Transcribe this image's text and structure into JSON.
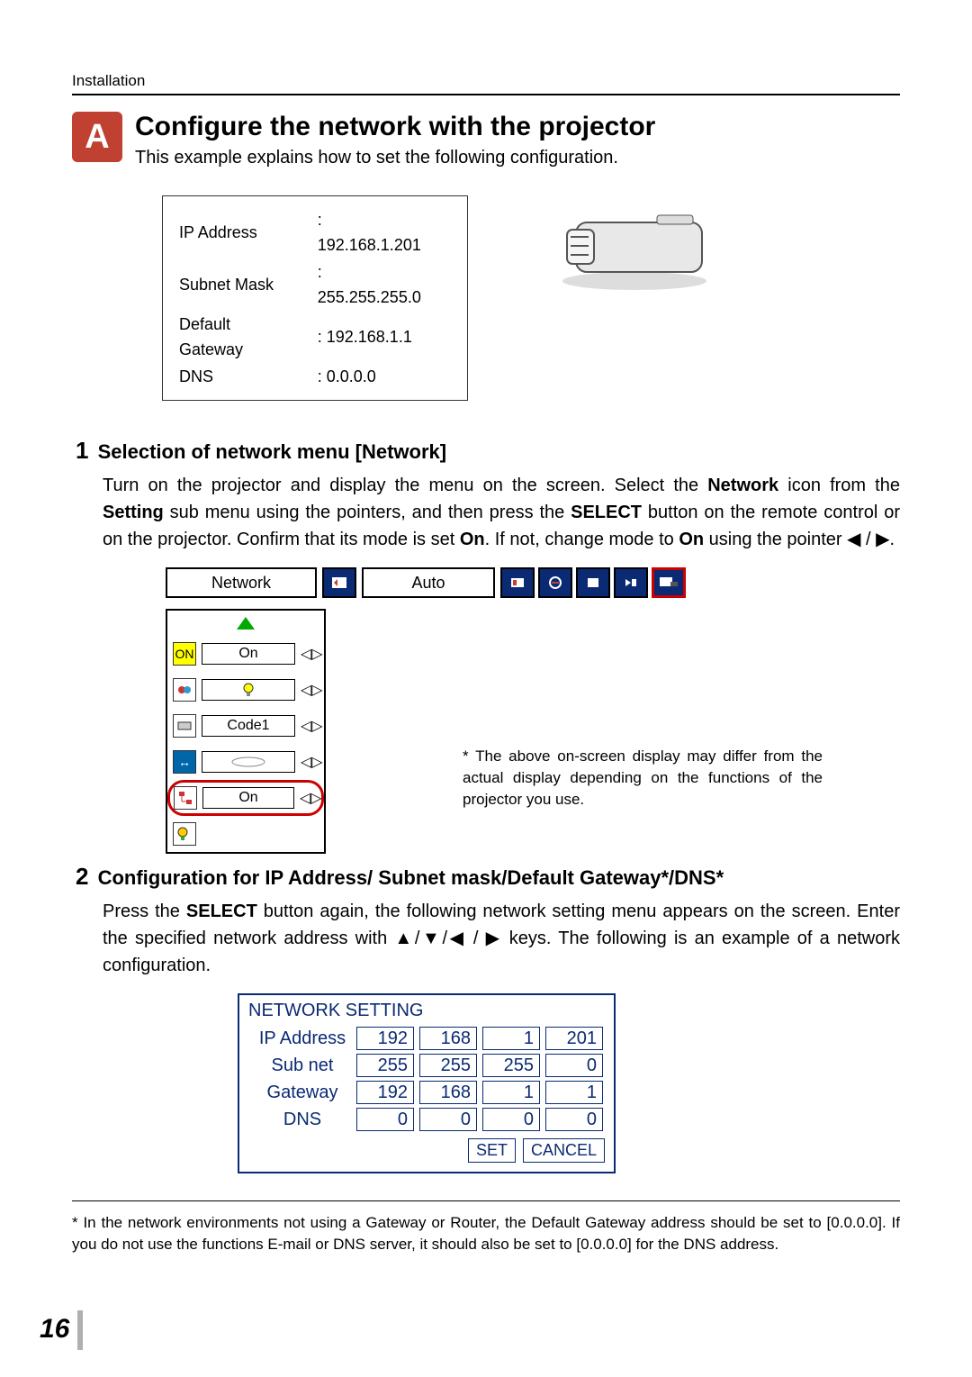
{
  "header": "Installation",
  "badge": "A",
  "title": "Configure the network with the projector",
  "subtitle": "This example explains how to set the following configuration.",
  "config": {
    "rows": [
      {
        "label": "IP Address",
        "value": ": 192.168.1.201"
      },
      {
        "label": "Subnet Mask",
        "value": ": 255.255.255.0"
      },
      {
        "label": "Default Gateway",
        "value": ": 192.168.1.1"
      },
      {
        "label": "DNS",
        "value": ": 0.0.0.0"
      }
    ]
  },
  "step1": {
    "num": "1",
    "heading": "Selection of network menu [Network]",
    "body_pre": "Turn on the projector and display the menu on the screen. Select the ",
    "body_b1": "Network",
    "body_mid1": " icon from the ",
    "body_b2": "Setting",
    "body_mid2": " sub menu using the pointers, and then press the ",
    "body_b3": "SELECT",
    "body_mid3": " button on the remote control or on the projector. Confirm that its mode is set ",
    "body_b4": "On",
    "body_mid4": ". If not, change mode to ",
    "body_b5": "On",
    "body_end": " using the pointer ◀ / ▶.",
    "menu_label": "Network",
    "menu_auto": "Auto",
    "rows": {
      "r1": "On",
      "r2": "",
      "r3": "Code1",
      "r4": "",
      "r5": "On"
    },
    "osd_note": "* The above on-screen display may differ from the actual display depending on the functions of the projector you use."
  },
  "step2": {
    "num": "2",
    "heading": "Configuration for IP Address/ Subnet mask/Default Gateway*/DNS*",
    "body_pre": "Press the ",
    "body_b1": "SELECT",
    "body_mid1": " button again, the following network setting menu appears on the screen. Enter the specified network address with ▲/▼/◀ / ▶ keys. The following is an example of a network configuration.",
    "panel": {
      "title": "NETWORK SETTING",
      "rows": [
        {
          "label": "IP Address",
          "cells": [
            "192",
            "168",
            "1",
            "201"
          ]
        },
        {
          "label": "Sub net",
          "cells": [
            "255",
            "255",
            "255",
            "0"
          ]
        },
        {
          "label": "Gateway",
          "cells": [
            "192",
            "168",
            "1",
            "1"
          ]
        },
        {
          "label": "DNS",
          "cells": [
            "0",
            "0",
            "0",
            "0"
          ]
        }
      ],
      "set": "SET",
      "cancel": "CANCEL"
    }
  },
  "footnote": "* In the network environments not using a Gateway or Router, the Default Gateway address should be set to [0.0.0.0]. If you do not use the functions E-mail or DNS server, it should also be set to [0.0.0.0] for the DNS address.",
  "page_number": "16"
}
